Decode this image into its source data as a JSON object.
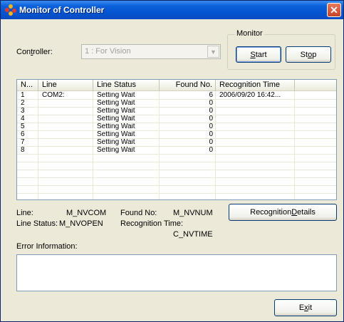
{
  "window": {
    "title": "Monitor of Controller",
    "close_glyph": "✕"
  },
  "controller": {
    "label_pre": "Con",
    "label_u": "t",
    "label_post": "roller:",
    "value": "1 : For Vision",
    "arrow": "▼"
  },
  "monitor": {
    "legend": "Monitor",
    "start_u": "S",
    "start_rest": "tart",
    "stop_pre": "St",
    "stop_u": "o",
    "stop_post": "p"
  },
  "table": {
    "headers": [
      "N...",
      "Line",
      "Line Status",
      "Found No.",
      "Recognition Time"
    ],
    "rows": [
      {
        "n": "1",
        "line": "COM2:",
        "status": "Setting Wait",
        "found": "6",
        "time": "2006/09/20 16:42..."
      },
      {
        "n": "2",
        "line": "",
        "status": "Setting Wait",
        "found": "0",
        "time": ""
      },
      {
        "n": "3",
        "line": "",
        "status": "Setting Wait",
        "found": "0",
        "time": ""
      },
      {
        "n": "4",
        "line": "",
        "status": "Setting Wait",
        "found": "0",
        "time": ""
      },
      {
        "n": "5",
        "line": "",
        "status": "Setting Wait",
        "found": "0",
        "time": ""
      },
      {
        "n": "6",
        "line": "",
        "status": "Setting Wait",
        "found": "0",
        "time": ""
      },
      {
        "n": "7",
        "line": "",
        "status": "Setting Wait",
        "found": "0",
        "time": ""
      },
      {
        "n": "8",
        "line": "",
        "status": "Setting Wait",
        "found": "0",
        "time": ""
      }
    ]
  },
  "info": {
    "line_label": "Line:",
    "line_value": "M_NVCOM",
    "found_label": "Found No:",
    "found_value": "M_NVNUM",
    "status_label": "Line Status:",
    "status_value": "M_NVOPEN",
    "time_label": "Recognition Time:",
    "time_value": "C_NVTIME"
  },
  "details_button": {
    "pre": "Recognition ",
    "u": "D",
    "post": "etails"
  },
  "error": {
    "label": "Error Information:"
  },
  "exit_button": {
    "pre": "E",
    "u": "x",
    "post": "it"
  }
}
